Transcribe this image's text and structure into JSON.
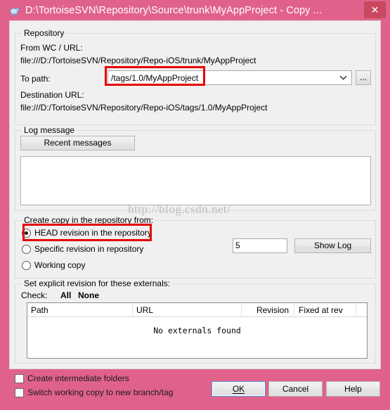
{
  "window": {
    "title": "D:\\TortoiseSVN\\Repository\\Source\\trunk\\MyAppProject - Copy ...",
    "close_label": "✕",
    "icon": "tortoisesvn-icon",
    "frame_color": "#e0628a",
    "close_button_color": "#c8485f"
  },
  "repository": {
    "group_title": "Repository",
    "from_label": "From WC / URL:",
    "from_url": "file:///D:/TortoiseSVN/Repository/Repo-iOS/trunk/MyAppProject",
    "to_path_label": "To path:",
    "to_path_value": "/tags/1.0/MyAppProject",
    "browse_label": "...",
    "destination_label": "Destination URL:",
    "destination_url": "file:///D:/TortoiseSVN/Repository/Repo-iOS/tags/1.0/MyAppProject"
  },
  "log_message": {
    "group_title": "Log message",
    "recent_messages_label": "Recent messages",
    "text_value": "",
    "placeholder": ""
  },
  "create_copy": {
    "group_title": "Create copy in the repository from:",
    "options": [
      {
        "label": "HEAD revision in the repository",
        "selected": true
      },
      {
        "label": "Specific revision in repository",
        "selected": false
      },
      {
        "label": "Working copy",
        "selected": false
      }
    ],
    "revision_value": "5",
    "show_log_label": "Show Log"
  },
  "externals": {
    "group_title": "Set explicit revision for these externals:",
    "check_label": "Check:",
    "check_all_label": "All",
    "check_none_label": "None",
    "columns": [
      "Path",
      "URL",
      "Revision",
      "Fixed at rev"
    ],
    "rows": [],
    "empty_text": "No externals found"
  },
  "bottom": {
    "checkboxes": [
      {
        "label": "Create intermediate folders",
        "checked": false
      },
      {
        "label": "Switch working copy to new branch/tag",
        "checked": false
      }
    ],
    "ok_label": "OK",
    "cancel_label": "Cancel",
    "help_label": "Help"
  },
  "watermark": {
    "text": "http://blog.csdn.net/"
  },
  "annotations": {
    "highlight_color": "#e60000",
    "boxes": [
      "to-path-field",
      "head-revision-radio"
    ]
  }
}
